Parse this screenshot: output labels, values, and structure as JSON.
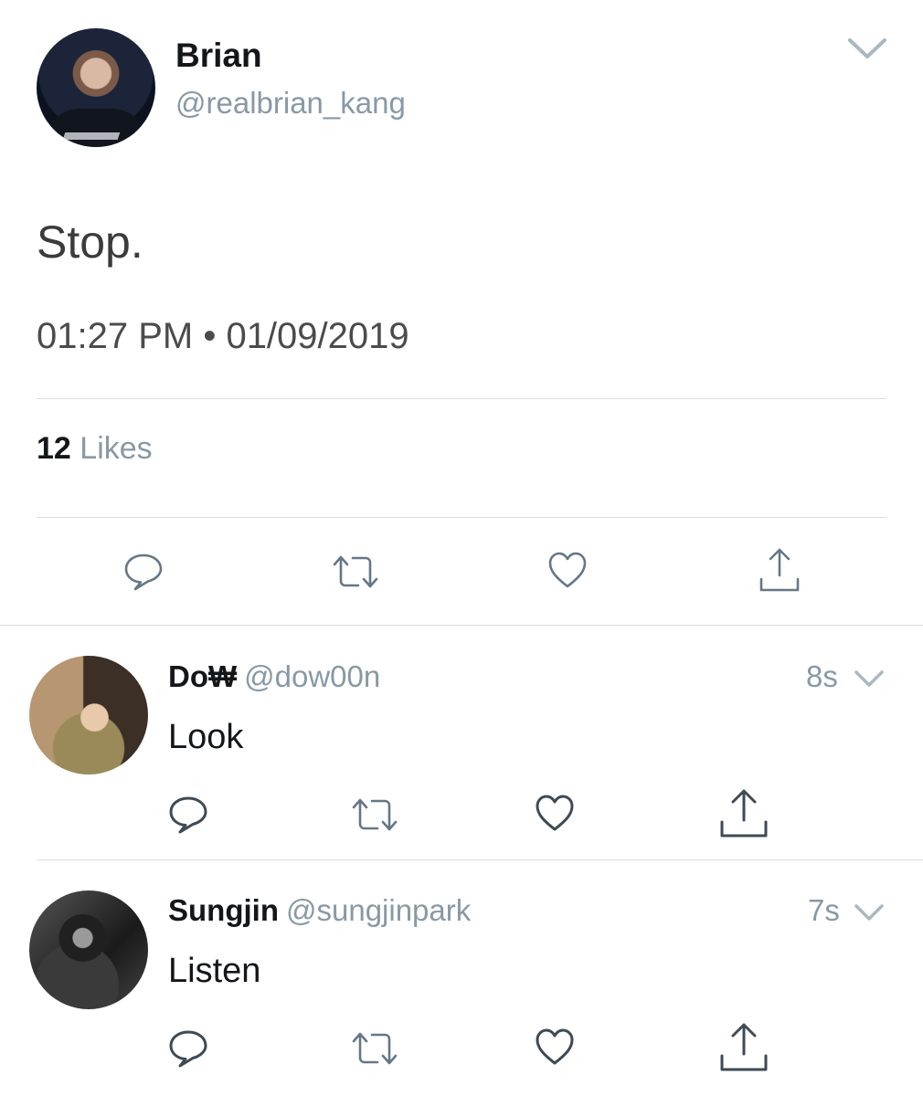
{
  "main_tweet": {
    "author_name": "Brian",
    "author_handle": "@realbrian_kang",
    "text": "Stop.",
    "timestamp": "01:27 PM • 01/09/2019",
    "likes_count": "12",
    "likes_label": "Likes"
  },
  "replies": [
    {
      "author_name": "Do₩",
      "author_handle": "@dow00n",
      "time": "8s",
      "text": "Look"
    },
    {
      "author_name": "Sungjin",
      "author_handle": "@sungjinpark",
      "time": "7s",
      "text": "Listen"
    }
  ],
  "icons": {
    "reply": "reply-icon",
    "retweet": "retweet-icon",
    "like": "heart-icon",
    "share": "share-icon",
    "menu": "chevron-down-icon"
  },
  "colors": {
    "secondary_text": "#8899a6",
    "primary_text": "#14171a",
    "icon": "#657786",
    "divider": "#dadcdf"
  }
}
